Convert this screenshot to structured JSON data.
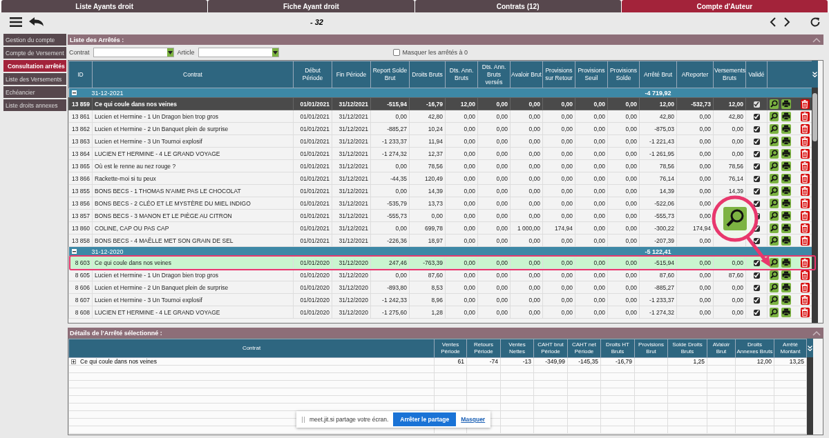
{
  "tabs": [
    {
      "label": "Liste Ayants droit",
      "selected": false
    },
    {
      "label": "Fiche Ayant droit",
      "selected": false
    },
    {
      "label": "Contrats (12)",
      "selected": false
    },
    {
      "label": "Compte d'Auteur",
      "selected": true
    }
  ],
  "toolbar": {
    "title": "- 32"
  },
  "sidebar": {
    "items": [
      {
        "label": "Gestion du compte",
        "selected": false
      },
      {
        "label": "Compte de Versement",
        "selected": false
      },
      {
        "label": "Consultation arrêtés",
        "selected": true
      },
      {
        "label": "Liste des Versements",
        "selected": false
      },
      {
        "label": "Echéancier",
        "selected": false
      },
      {
        "label": "Liste droits annexes",
        "selected": false
      }
    ]
  },
  "arretes": {
    "title": "Liste des Arrêtés :",
    "filters": {
      "contrat_label": "Contrat",
      "article_label": "Article",
      "hide_zero": {
        "label": "Masquer les arrêtés à 0",
        "checked": false
      }
    },
    "columns": [
      "ID",
      "Contrat",
      "Début Période",
      "Fin Période",
      "Report Solde Brut",
      "Droits Bruts",
      "Dts. Ann. Bruts",
      "Dts. Ann. Bruts versés",
      "Avaloir Brut",
      "Provisions sur Retour",
      "Provisions Seuil",
      "Provisions Solde",
      "Arrêté Brut",
      "AReporter",
      "Versements Bruts",
      "Validé"
    ],
    "groups": [
      {
        "label": "31-12-2021",
        "total": "-4 719,92",
        "expanded": true,
        "rows": [
          {
            "id": "13 859",
            "contrat": "Ce qui coule dans nos veines",
            "debut": "01/01/2021",
            "fin": "31/12/2021",
            "values": [
              "-515,94",
              "-16,79",
              "12,00",
              "0,00",
              "0,00",
              "0,00",
              "0,00",
              "0,00",
              "12,00",
              "-532,73"
            ],
            "versements": "12,00",
            "validated": true,
            "kind": "dark",
            "selected": false
          },
          {
            "id": "13 861",
            "contrat": "Lucien et Hermine - 1 Un Dragon bien trop gros",
            "debut": "01/01/2021",
            "fin": "31/12/2021",
            "values": [
              "0,00",
              "42,80",
              "0,00",
              "0,00",
              "0,00",
              "0,00",
              "0,00",
              "0,00",
              "42,80",
              "0,00"
            ],
            "versements": "42,80",
            "validated": true,
            "kind": "plain",
            "selected": false
          },
          {
            "id": "13 862",
            "contrat": "Lucien et Hermine - 2 Un Banquet plein de surprise",
            "debut": "01/01/2021",
            "fin": "31/12/2021",
            "values": [
              "-885,27",
              "10,24",
              "0,00",
              "0,00",
              "0,00",
              "0,00",
              "0,00",
              "0,00",
              "-875,03",
              "0,00"
            ],
            "versements": "0,00",
            "validated": true,
            "kind": "plain",
            "selected": false
          },
          {
            "id": "13 863",
            "contrat": "Lucien et Hermine - 3 Un Tournoi explosif",
            "debut": "01/01/2021",
            "fin": "31/12/2021",
            "values": [
              "-1 233,37",
              "11,94",
              "0,00",
              "0,00",
              "0,00",
              "0,00",
              "0,00",
              "0,00",
              "-1 221,43",
              "0,00"
            ],
            "versements": "0,00",
            "validated": true,
            "kind": "plain",
            "selected": false
          },
          {
            "id": "13 864",
            "contrat": "LUCIEN ET HERMINE - 4 LE GRAND VOYAGE",
            "debut": "01/01/2021",
            "fin": "31/12/2021",
            "values": [
              "-1 274,32",
              "12,37",
              "0,00",
              "0,00",
              "0,00",
              "0,00",
              "0,00",
              "0,00",
              "-1 261,95",
              "0,00"
            ],
            "versements": "0,00",
            "validated": true,
            "kind": "plain",
            "selected": false
          },
          {
            "id": "13 865",
            "contrat": "Où est le renne au nez rouge ?",
            "debut": "01/01/2021",
            "fin": "31/12/2021",
            "values": [
              "0,00",
              "78,56",
              "0,00",
              "0,00",
              "0,00",
              "0,00",
              "0,00",
              "0,00",
              "78,56",
              "0,00"
            ],
            "versements": "78,56",
            "validated": true,
            "kind": "plain",
            "selected": false
          },
          {
            "id": "13 866",
            "contrat": "Rackette-moi si tu peux",
            "debut": "01/01/2021",
            "fin": "31/12/2021",
            "values": [
              "-44,35",
              "120,49",
              "0,00",
              "0,00",
              "0,00",
              "0,00",
              "0,00",
              "0,00",
              "76,14",
              "0,00"
            ],
            "versements": "76,14",
            "validated": true,
            "kind": "plain",
            "selected": false
          },
          {
            "id": "13 855",
            "contrat": "BONS BECS - 1 THOMAS N'AIME PAS LE CHOCOLAT",
            "debut": "01/01/2021",
            "fin": "31/12/2021",
            "values": [
              "0,00",
              "14,39",
              "0,00",
              "0,00",
              "0,00",
              "0,00",
              "0,00",
              "0,00",
              "14,39",
              "0,00"
            ],
            "versements": "14,39",
            "validated": true,
            "kind": "plain",
            "selected": false
          },
          {
            "id": "13 856",
            "contrat": "BONS BECS - 2 CLÉO ET LE MYSTÈRE DU MIEL INDIGO",
            "debut": "01/01/2021",
            "fin": "31/12/2021",
            "values": [
              "-535,79",
              "13,73",
              "0,00",
              "0,00",
              "0,00",
              "0,00",
              "0,00",
              "0,00",
              "-522,06",
              "0,00"
            ],
            "validated": true,
            "kind": "plain",
            "selected": false
          },
          {
            "id": "13 857",
            "contrat": "BONS BECS - 3 MANON ET LE PIÈGE AU CITRON",
            "debut": "01/01/2021",
            "fin": "31/12/2021",
            "values": [
              "-555,73",
              "0,00",
              "0,00",
              "0,00",
              "0,00",
              "0,00",
              "0,00",
              "0,00",
              "-555,73",
              "0,00"
            ],
            "validated": true,
            "kind": "plain",
            "selected": false
          },
          {
            "id": "13 860",
            "contrat": "COLINE, CAP OU PAS CAP",
            "debut": "01/01/2021",
            "fin": "31/12/2021",
            "values": [
              "0,00",
              "699,78",
              "0,00",
              "0,00",
              "1 000,00",
              "174,94",
              "0,00",
              "0,00",
              "-300,22",
              "174,94"
            ],
            "validated": true,
            "kind": "plain",
            "selected": false
          },
          {
            "id": "13 858",
            "contrat": "BONS BECS - 4 MAËLLE MET SON GRAIN DE SEL",
            "debut": "01/01/2021",
            "fin": "31/12/2021",
            "values": [
              "-226,36",
              "18,97",
              "0,00",
              "0,00",
              "0,00",
              "0,00",
              "0,00",
              "0,00",
              "-207,39",
              "0,00"
            ],
            "validated": true,
            "kind": "plain",
            "selected": false
          }
        ]
      },
      {
        "label": "31-12-2020",
        "total": "-5 122,41",
        "expanded": true,
        "rows": [
          {
            "id": "8 603",
            "contrat": "Ce qui coule dans nos veines",
            "debut": "01/01/2020",
            "fin": "31/12/2020",
            "values": [
              "247,46",
              "-763,39",
              "0,00",
              "0,00",
              "0,00",
              "0,00",
              "0,00",
              "0,00",
              "-515,94",
              "0,00"
            ],
            "versements": "0,00",
            "validated": true,
            "kind": "plain",
            "selected": true
          },
          {
            "id": "8 605",
            "contrat": "Lucien et Hermine - 1 Un Dragon bien trop gros",
            "debut": "01/01/2020",
            "fin": "31/12/2020",
            "values": [
              "0,00",
              "87,60",
              "0,00",
              "0,00",
              "0,00",
              "0,00",
              "0,00",
              "0,00",
              "87,60",
              "0,00"
            ],
            "versements": "87,60",
            "validated": true,
            "kind": "plain",
            "selected": false
          },
          {
            "id": "8 606",
            "contrat": "Lucien et Hermine - 2 Un Banquet plein de surprise",
            "debut": "01/01/2020",
            "fin": "31/12/2020",
            "values": [
              "-893,80",
              "8,53",
              "0,00",
              "0,00",
              "0,00",
              "0,00",
              "0,00",
              "0,00",
              "-885,27",
              "0,00"
            ],
            "versements": "0,00",
            "validated": true,
            "kind": "plain",
            "selected": false
          },
          {
            "id": "8 607",
            "contrat": "Lucien et Hermine - 3 Un Tournoi explosif",
            "debut": "01/01/2020",
            "fin": "31/12/2020",
            "values": [
              "-1 242,33",
              "8,96",
              "0,00",
              "0,00",
              "0,00",
              "0,00",
              "0,00",
              "0,00",
              "-1 233,37",
              "0,00"
            ],
            "versements": "0,00",
            "validated": true,
            "kind": "plain",
            "selected": false
          },
          {
            "id": "8 608",
            "contrat": "LUCIEN ET HERMINE - 4 LE GRAND VOYAGE",
            "debut": "01/01/2020",
            "fin": "31/12/2020",
            "values": [
              "-1 275,60",
              "1,28",
              "0,00",
              "0,00",
              "0,00",
              "0,00",
              "0,00",
              "0,00",
              "-1 274,32",
              "0,00"
            ],
            "versements": "0,00",
            "validated": true,
            "kind": "plain",
            "selected": false
          }
        ]
      }
    ]
  },
  "details": {
    "title": "Détails de l'Arrêté sélectionné :",
    "columns": [
      "Contrat",
      "Ventes Période",
      "Retours Période",
      "Ventes Nettes",
      "CAHT brut Période",
      "CAHT net Période",
      "Droits HT Bruts",
      "Provisions Brut",
      "Solde Droits Bruts",
      "AValoir Brut",
      "Droits Annexes Bruts",
      "Arrêté Montant"
    ],
    "rows": [
      {
        "contrat": "Ce qui coule dans nos veines",
        "expanded": false,
        "cells": {
          "ventes_periode": "61",
          "retours_periode": "-74",
          "ventes_nettes": "-13",
          "caht_brut": "-349,99",
          "caht_net": "-145,35",
          "droits_ht": "-16,79",
          "solde_droits": "1,25",
          "droits_annexes": "12,00",
          "arrete_montant": "13,25"
        }
      }
    ]
  },
  "share_bar": {
    "message": "meet.jit.si partage votre écran.",
    "stop_button": "Arrêter le partage",
    "hide_link": "Masquer"
  }
}
